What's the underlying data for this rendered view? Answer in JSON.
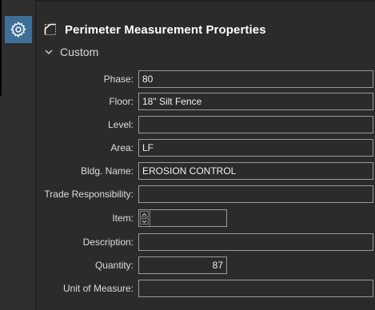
{
  "header": {
    "title": "Perimeter Measurement Properties"
  },
  "section": {
    "label": "Custom"
  },
  "fields": {
    "phase": {
      "label": "Phase:",
      "value": "80"
    },
    "floor": {
      "label": "Floor:",
      "value": "18\" Silt Fence"
    },
    "level": {
      "label": "Level:",
      "value": ""
    },
    "area": {
      "label": "Area:",
      "value": "LF"
    },
    "bldg_name": {
      "label": "Bldg. Name:",
      "value": "EROSION CONTROL"
    },
    "trade_responsibility": {
      "label": "Trade Responsibility:",
      "value": ""
    },
    "item": {
      "label": "Item:",
      "value": ""
    },
    "description": {
      "label": "Description:",
      "value": ""
    },
    "quantity": {
      "label": "Quantity:",
      "value": "87"
    },
    "unit_of_measure": {
      "label": "Unit of Measure:",
      "value": ""
    }
  },
  "colors": {
    "accent": "#3d6f97",
    "panel_bg": "#2b2b2b",
    "rail_bg": "#2e2e2e",
    "field_border": "#9a9a9a"
  },
  "icons": {
    "rail_button": "gear-icon",
    "header": "perimeter-measurement-icon",
    "section_toggle": "chevron-down-icon"
  }
}
